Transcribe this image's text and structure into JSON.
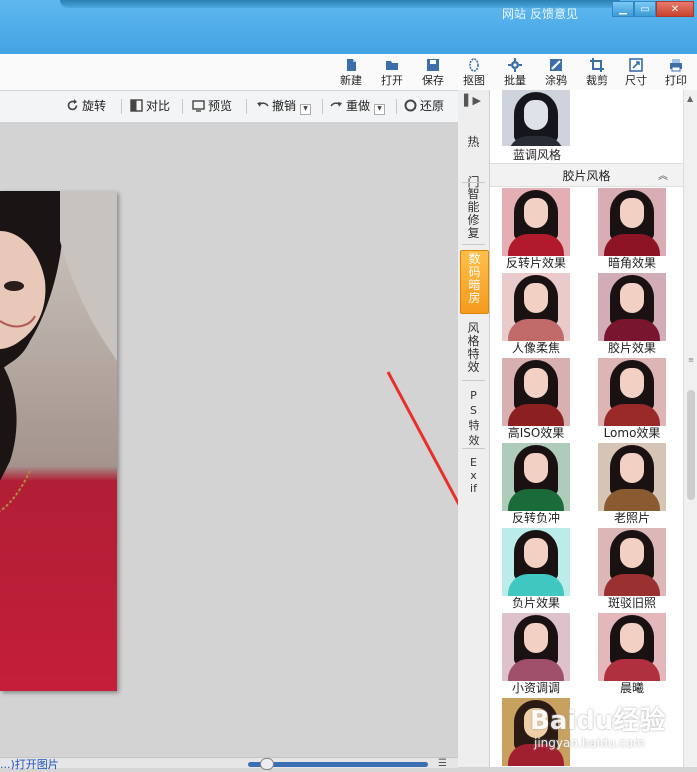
{
  "title_bar": {
    "links": [
      "网站",
      "反馈意见"
    ],
    "window_buttons": [
      "minimize",
      "maximize",
      "close"
    ]
  },
  "main_toolbar": {
    "items": [
      {
        "label": "新建",
        "icon": "new-file-icon"
      },
      {
        "label": "打开",
        "icon": "folder-open-icon"
      },
      {
        "label": "保存",
        "icon": "save-icon"
      },
      {
        "label": "抠图",
        "icon": "cutout-icon"
      },
      {
        "label": "批量",
        "icon": "batch-gear-icon"
      },
      {
        "label": "涂鸦",
        "icon": "doodle-icon"
      },
      {
        "label": "裁剪",
        "icon": "crop-icon"
      },
      {
        "label": "尺寸",
        "icon": "resize-icon"
      },
      {
        "label": "打印",
        "icon": "printer-icon"
      }
    ]
  },
  "edit_toolbar": {
    "rotate": "旋转",
    "compare": "对比",
    "preview": "预览",
    "undo": "撤销",
    "redo": "重做",
    "restore": "还原"
  },
  "side_tabs": [
    {
      "label": "热门",
      "active": false
    },
    {
      "label": "智能修复",
      "active": false
    },
    {
      "label": "数码暗房",
      "active": true
    },
    {
      "label": "风格特效",
      "active": false
    },
    {
      "label": "PS特效",
      "active": false
    },
    {
      "label": "Exif",
      "active": false
    }
  ],
  "effects_panel": {
    "prev_item": {
      "label": "蓝调风格"
    },
    "section_title": "胶片风格",
    "items": [
      {
        "label": "反转片效果",
        "tone": "#b01a2c"
      },
      {
        "label": "暗角效果",
        "tone": "#8d1425"
      },
      {
        "label": "人像柔焦",
        "tone": "#c06a6a"
      },
      {
        "label": "胶片效果",
        "tone": "#7a1530"
      },
      {
        "label": "高ISO效果",
        "tone": "#8c2020"
      },
      {
        "label": "Lomo效果",
        "tone": "#9a2a2a"
      },
      {
        "label": "反转负冲",
        "tone": "#1a6a3a"
      },
      {
        "label": "老照片",
        "tone": "#8a5a30"
      },
      {
        "label": "负片效果",
        "tone": "#40c8c0"
      },
      {
        "label": "斑驳旧照",
        "tone": "#9a3030"
      },
      {
        "label": "小资调调",
        "tone": "#a0506a"
      },
      {
        "label": "晨曦",
        "tone": "#b03040"
      }
    ]
  },
  "status": {
    "link_text": "...)打开图片"
  },
  "colors": {
    "title_bar": "#4aa8e6",
    "active_tab": "#f5a024",
    "arrow": "#e8302a"
  },
  "watermark": {
    "brand": "Baidu经验",
    "url": "jingyan.baidu.com"
  }
}
